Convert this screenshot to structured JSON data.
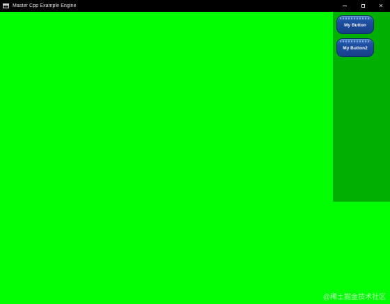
{
  "window": {
    "title": "Master Cpp Example Engine",
    "controls": {
      "minimize": "minimize",
      "maximize": "maximize",
      "close": "✕"
    }
  },
  "panel": {
    "buttons": [
      {
        "label": "My Button"
      },
      {
        "label": "My Button2"
      }
    ]
  },
  "watermark": "@稀土掘金技术社区",
  "colors": {
    "background": "#00ff00",
    "panel": "#00b000",
    "button": "#1e4fa0",
    "titlebar": "#000000"
  }
}
